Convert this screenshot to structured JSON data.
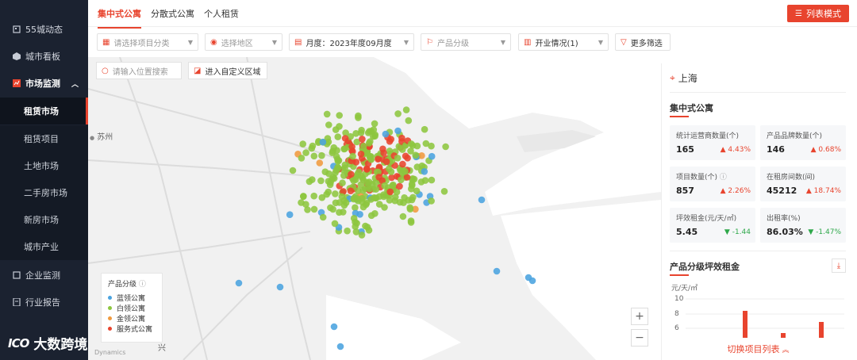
{
  "sidebar": {
    "items": [
      {
        "label": "55城动态",
        "icon": "building-icon"
      },
      {
        "label": "城市看板",
        "icon": "cube-icon"
      },
      {
        "label": "市场监测",
        "icon": "chart-icon"
      }
    ],
    "submenu": [
      "租赁市场",
      "租赁项目",
      "土地市场",
      "二手房市场",
      "新房市场",
      "城市产业"
    ],
    "bottom_items": [
      {
        "label": "企业监测",
        "icon": "building-icon"
      },
      {
        "label": "行业报告",
        "icon": "report-icon"
      }
    ],
    "logo_mark": "ICO",
    "logo_text": "大数跨境"
  },
  "tabs": [
    "集中式公寓",
    "分散式公寓",
    "个人租赁"
  ],
  "list_mode_button": "列表模式",
  "filters": {
    "category_placeholder": "请选择项目分类",
    "region_placeholder": "选择地区",
    "month": "月度：2023年度09月度",
    "grade_placeholder": "产品分级",
    "status": "开业情况(1)",
    "more": "更多筛选"
  },
  "map": {
    "search_placeholder": "请输入位置搜索",
    "custom_zone": "进入自定义区域",
    "label_suzhou": "苏州",
    "label_jiaxing": "兴",
    "attribution": "Dynamics",
    "legend": {
      "title": "产品分级",
      "items": [
        {
          "label": "蓝领公寓",
          "color": "#4aa3df"
        },
        {
          "label": "白领公寓",
          "color": "#8dc63f"
        },
        {
          "label": "金领公寓",
          "color": "#f09a3e"
        },
        {
          "label": "服务式公寓",
          "color": "#e8442e"
        }
      ]
    },
    "zoom_in": "+",
    "zoom_out": "−"
  },
  "panel": {
    "city": "上海",
    "section_title": "集中式公寓",
    "cards": [
      {
        "label": "统计运营商数量(个)",
        "value": "165",
        "change": "4.43%",
        "dir": "up"
      },
      {
        "label": "产品品牌数量(个)",
        "value": "146",
        "change": "0.68%",
        "dir": "up"
      },
      {
        "label": "项目数量(个)",
        "value": "857",
        "change": "2.26%",
        "dir": "up"
      },
      {
        "label": "在租房间数(间)",
        "value": "45212",
        "change": "18.74%",
        "dir": "up"
      },
      {
        "label": "坪效租金(元/天/㎡)",
        "value": "5.45",
        "change": "-1.44",
        "dir": "down"
      },
      {
        "label": "出租率(%)",
        "value": "86.03%",
        "change": "-1.47%",
        "dir": "down"
      }
    ],
    "chart_title": "产品分级坪效租金",
    "chart_unit": "元/天/㎡",
    "ticks": [
      "10",
      "8",
      "6"
    ],
    "toggle_label": "切换项目列表"
  },
  "colors": {
    "accent": "#e8442e",
    "sidebar_bg": "#1b2230",
    "white_collar": "#8dc63f",
    "blue_collar": "#4aa3df",
    "gold_collar": "#f09a3e",
    "service": "#e8442e"
  }
}
